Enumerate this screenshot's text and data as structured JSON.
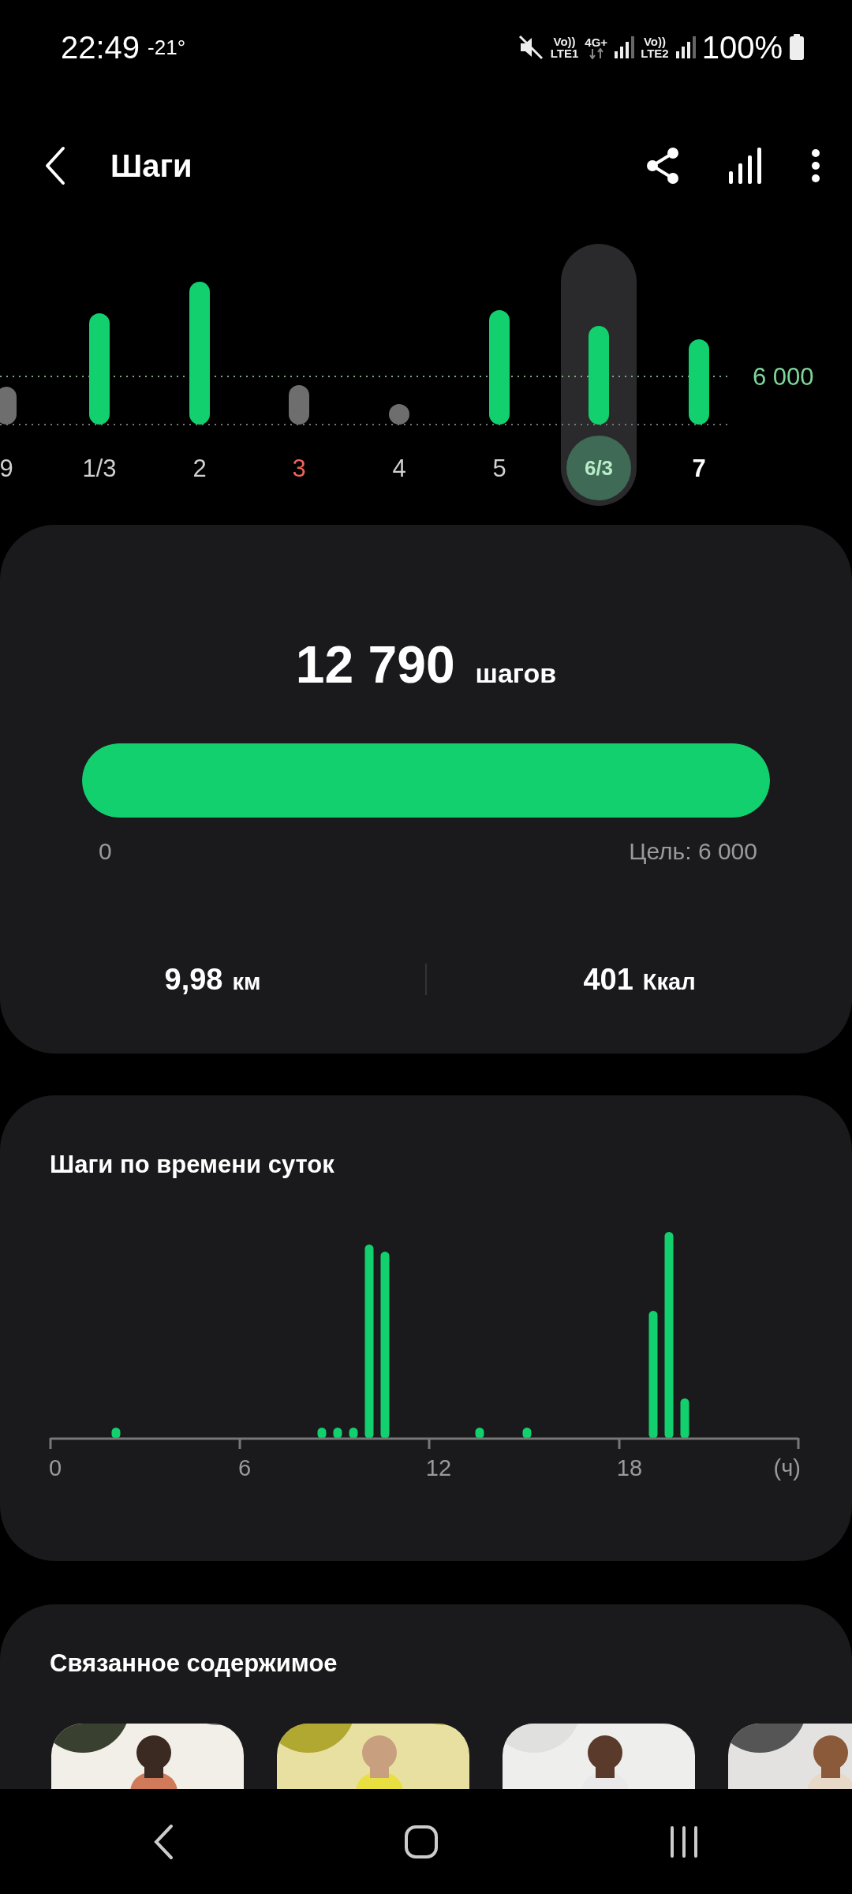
{
  "status_bar": {
    "time": "22:49",
    "temperature": "-21°",
    "sim1": {
      "volte": "Vo))",
      "network": "LTE1"
    },
    "data_type": "4G+",
    "sim2": {
      "volte": "Vo))",
      "network": "LTE2"
    },
    "battery": "100%"
  },
  "header": {
    "title": "Шаги"
  },
  "week": {
    "goal_label": "6 000",
    "days": [
      {
        "label": "9",
        "kind": "weekday",
        "goal_met": false,
        "selected": false
      },
      {
        "label": "1/3",
        "kind": "weekday",
        "goal_met": true,
        "selected": false
      },
      {
        "label": "2",
        "kind": "weekday",
        "goal_met": true,
        "selected": false
      },
      {
        "label": "3",
        "kind": "weekend",
        "goal_met": false,
        "selected": false
      },
      {
        "label": "4",
        "kind": "weekday",
        "goal_met": false,
        "selected": false
      },
      {
        "label": "5",
        "kind": "weekday",
        "goal_met": true,
        "selected": false
      },
      {
        "label": "6/3",
        "kind": "weekday",
        "goal_met": true,
        "selected": true
      },
      {
        "label": "7",
        "kind": "today",
        "goal_met": true,
        "selected": false
      }
    ]
  },
  "summary": {
    "steps": "12 790",
    "steps_unit": "шагов",
    "level": 1,
    "start_label": "0",
    "goal_label": "Цель: 6 000",
    "distance": "9,98",
    "distance_unit": "км",
    "calories": "401",
    "calories_unit": "Ккал"
  },
  "hourly": {
    "title": "Шаги по времени суток",
    "axis_labels": [
      "0",
      "6",
      "12",
      "18",
      "(ч)"
    ]
  },
  "related": {
    "title": "Связанное содержимое"
  }
}
